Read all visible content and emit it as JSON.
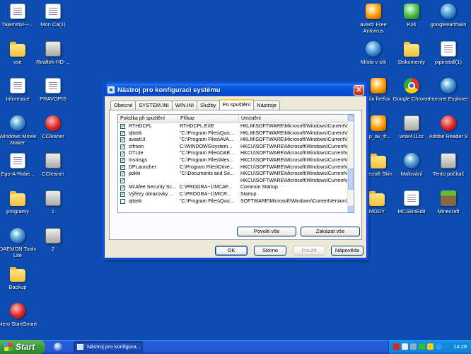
{
  "desktop": {
    "icons": [
      {
        "label": "Tajemstvi---...",
        "icon": "document-icon"
      },
      {
        "label": "Mon  Ca(1)",
        "icon": "document-icon"
      },
      {
        "label": "vse",
        "icon": "folder-icon"
      },
      {
        "label": "Realtek-HD-...",
        "icon": "audio-icon"
      },
      {
        "label": "Informace",
        "icon": "document-icon"
      },
      {
        "label": "PRAVOPIS",
        "icon": "document-icon"
      },
      {
        "label": "Windows Movie Maker",
        "icon": "movie-maker-icon"
      },
      {
        "label": "CCleaner",
        "icon": "ccleaner-icon"
      },
      {
        "label": "Ego-A-Robe...",
        "icon": "document-icon"
      },
      {
        "label": "CCleaner",
        "icon": "installer-icon"
      },
      {
        "label": "programy",
        "icon": "folder-icon"
      },
      {
        "label": "1",
        "icon": "document-icon"
      },
      {
        "label": "DAEMON Tools Lite",
        "icon": "daemon-tools-icon"
      },
      {
        "label": "2",
        "icon": "document-icon"
      },
      {
        "label": "Backup",
        "icon": "folder-icon"
      },
      {
        "label": "Nero StartSmart",
        "icon": "nero-icon"
      },
      {
        "label": "avast! Free Antivirus",
        "icon": "avast-icon"
      },
      {
        "label": "Koš",
        "icon": "recycle-bin-icon"
      },
      {
        "label": "googleearthwin",
        "icon": "google-earth-icon"
      },
      {
        "label": "Místa v síti",
        "icon": "network-places-icon"
      },
      {
        "label": "Dokumenty",
        "icon": "folder-icon"
      },
      {
        "label": "jxpinstall(1)",
        "icon": "java-icon"
      },
      {
        "label": "zila firefox",
        "icon": "firefox-icon"
      },
      {
        "label": "Google Chrome",
        "icon": "chrome-icon"
      },
      {
        "label": "Internet Explorer",
        "icon": "ie-icon"
      },
      {
        "label": "up_av_fr...",
        "icon": "document-icon"
      },
      {
        "label": "wrar411cz",
        "icon": "winrar-icon"
      },
      {
        "label": "Adobe Reader 9",
        "icon": "adobe-reader-icon"
      },
      {
        "label": "necraft Skin",
        "icon": "folder-icon"
      },
      {
        "label": "Malování",
        "icon": "paint-icon"
      },
      {
        "label": "Tento počítač",
        "icon": "my-computer-icon"
      },
      {
        "label": "MODY",
        "icon": "folder-icon"
      },
      {
        "label": "MCSkinEdit",
        "icon": "document-icon"
      },
      {
        "label": "Minecraft",
        "icon": "minecraft-icon"
      }
    ]
  },
  "dialog": {
    "title": "Nástroj pro konfiguraci systému",
    "close_label": "✕",
    "tabs": [
      "Obecné",
      "SYSTEM.INI",
      "WIN.INI",
      "Služby",
      "Po spuštění",
      "Nástroje"
    ],
    "active_tab": "Po spuštění",
    "columns": [
      "Položka při spuštění",
      "Příkaz",
      "Umístění"
    ],
    "rows": [
      {
        "checked": true,
        "item": "RTHDCPL",
        "command": "RTHDCPL.EXE",
        "location": "HKLM\\SOFTWARE\\Microsoft\\Windows\\CurrentVer..."
      },
      {
        "checked": true,
        "item": "qttask",
        "command": "\"C:\\Program Files\\Quic...",
        "location": "HKLM\\SOFTWARE\\Microsoft\\Windows\\CurrentVer..."
      },
      {
        "checked": true,
        "item": "avastUI",
        "command": "\"C:\\Program Files\\AVA...",
        "location": "HKLM\\SOFTWARE\\Microsoft\\Windows\\CurrentVer..."
      },
      {
        "checked": true,
        "item": "ctfmon",
        "command": "C:\\WINDOWS\\system...",
        "location": "HKCU\\SOFTWARE\\Microsoft\\Windows\\CurrentVer..."
      },
      {
        "checked": true,
        "item": "DTLite",
        "command": "\"C:\\Program Files\\DAE...",
        "location": "HKCU\\SOFTWARE\\Microsoft\\Windows\\CurrentVer..."
      },
      {
        "checked": true,
        "item": "msmsgs",
        "command": "\"C:\\Program Files\\Mes...",
        "location": "HKCU\\SOFTWARE\\Microsoft\\Windows\\CurrentVer..."
      },
      {
        "checked": true,
        "item": "DPLauncher",
        "command": "C:\\Program Files\\Drive...",
        "location": "HKCU\\SOFTWARE\\Microsoft\\Windows\\CurrentVer..."
      },
      {
        "checked": true,
        "item": "pokki",
        "command": "\"C:\\Documents and Se...",
        "location": "HKCU\\SOFTWARE\\Microsoft\\Windows\\CurrentVer..."
      },
      {
        "checked": true,
        "item": "",
        "command": "",
        "location": "HKCU\\SOFTWARE\\Microsoft\\Windows\\CurrentVer..."
      },
      {
        "checked": true,
        "item": "McAfee Security Sc...",
        "command": "C:\\PROGRA~1\\MCAF...",
        "location": "Common Startup"
      },
      {
        "checked": true,
        "item": "Výřezy obrazovky ...",
        "command": "C:\\PROGRA~1\\MICR...",
        "location": "Startup"
      },
      {
        "checked": false,
        "item": "qttask",
        "command": "\"C:\\Program Files\\Quic...",
        "location": "SOFTWARE\\Microsoft\\Windows\\CurrentVersion\\Ru..."
      }
    ],
    "enable_all": "Povolit vše",
    "disable_all": "Zakázat vše",
    "ok": "OK",
    "cancel": "Storno",
    "apply": "Použít",
    "help": "Nápověda"
  },
  "taskbar": {
    "start_label": "Start",
    "task_item": "Nástroj pro konfigura...",
    "clock": "14:29"
  },
  "colors": {
    "desktop": "#0d4cb0",
    "titlebar": "#0550d6",
    "start": "#3c9a3c",
    "check": "#21a121"
  }
}
